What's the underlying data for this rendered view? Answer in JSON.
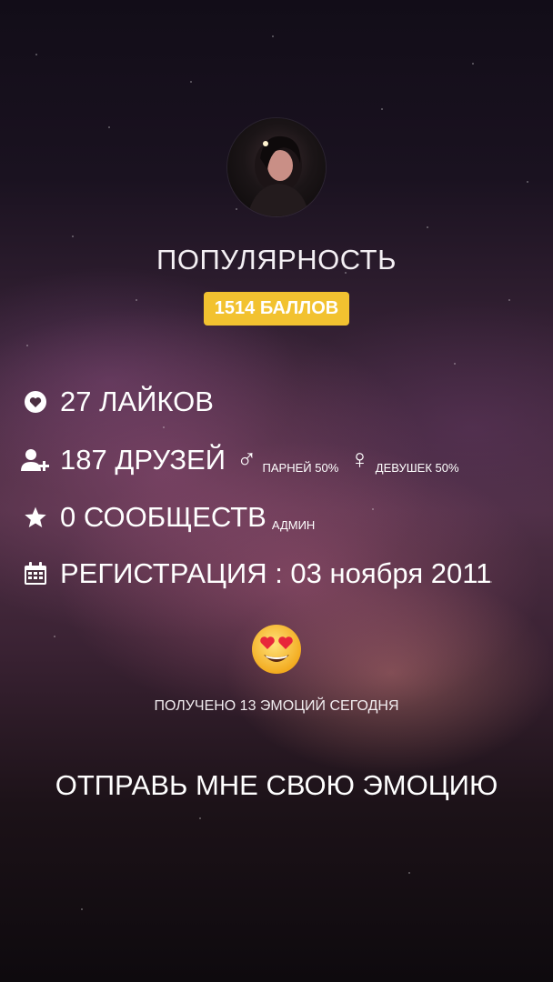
{
  "profile": {
    "popularity_title": "ПОПУЛЯРНОСТЬ",
    "points_badge": "1514 БАЛЛОВ"
  },
  "stats": {
    "likes": {
      "icon": "heart-icon",
      "text": "27 ЛАЙКОВ"
    },
    "friends": {
      "icon": "add-friend-icon",
      "text": "187 ДРУЗЕЙ",
      "male_symbol": "♂",
      "male_text": "ПАРНЕЙ 50%",
      "female_symbol": "♀",
      "female_text": "ДЕВУШЕК 50%"
    },
    "communities": {
      "icon": "star-icon",
      "text": "0 СООБЩЕСТВ",
      "sub": "АДМИН"
    },
    "registration": {
      "icon": "calendar-icon",
      "text": "РЕГИСТРАЦИЯ : 03 ноября 2011"
    }
  },
  "emotion": {
    "icon": "heart-eyes-emoji-icon",
    "received_text": "ПОЛУЧЕНО 13 ЭМОЦИЙ СЕГОДНЯ",
    "send_button": "ОТПРАВЬ МНЕ СВОЮ ЭМОЦИЮ"
  },
  "colors": {
    "badge": "#f2c230",
    "text": "#ffffff"
  }
}
